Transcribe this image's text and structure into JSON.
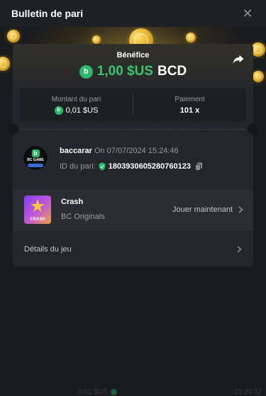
{
  "header": {
    "title": "Bulletin de pari",
    "close_icon": "close-icon"
  },
  "benefit": {
    "label": "Bénéfice",
    "amount": "1,00 $US",
    "currency": "BCD",
    "currency_icon": "bcd-coin-icon",
    "currency_icon_letter": "b",
    "amount_color": "#3bc56f"
  },
  "stats": {
    "stake_label": "Montant du pari",
    "stake_value": "0,01 $US",
    "payout_label": "Paiement",
    "payout_value": "101 x"
  },
  "bet": {
    "game": "baccarar",
    "on_text": "On 07/07/2024 15:24:46",
    "id_label": "ID du pari:",
    "id_value": "1803930605280760123",
    "avatar_letter": "b",
    "avatar_text": "BC GAME"
  },
  "game": {
    "name": "Crash",
    "provider": "BC Originals",
    "play_label": "Jouer maintenant",
    "thumb_text": "CRASH"
  },
  "details": {
    "label": "Détails du jeu"
  },
  "footer": {
    "amount": "0.01 $US",
    "time": "15:30:32"
  },
  "colors": {
    "accent_green": "#2bb86a",
    "background": "#17181b",
    "card": "#25262b"
  }
}
